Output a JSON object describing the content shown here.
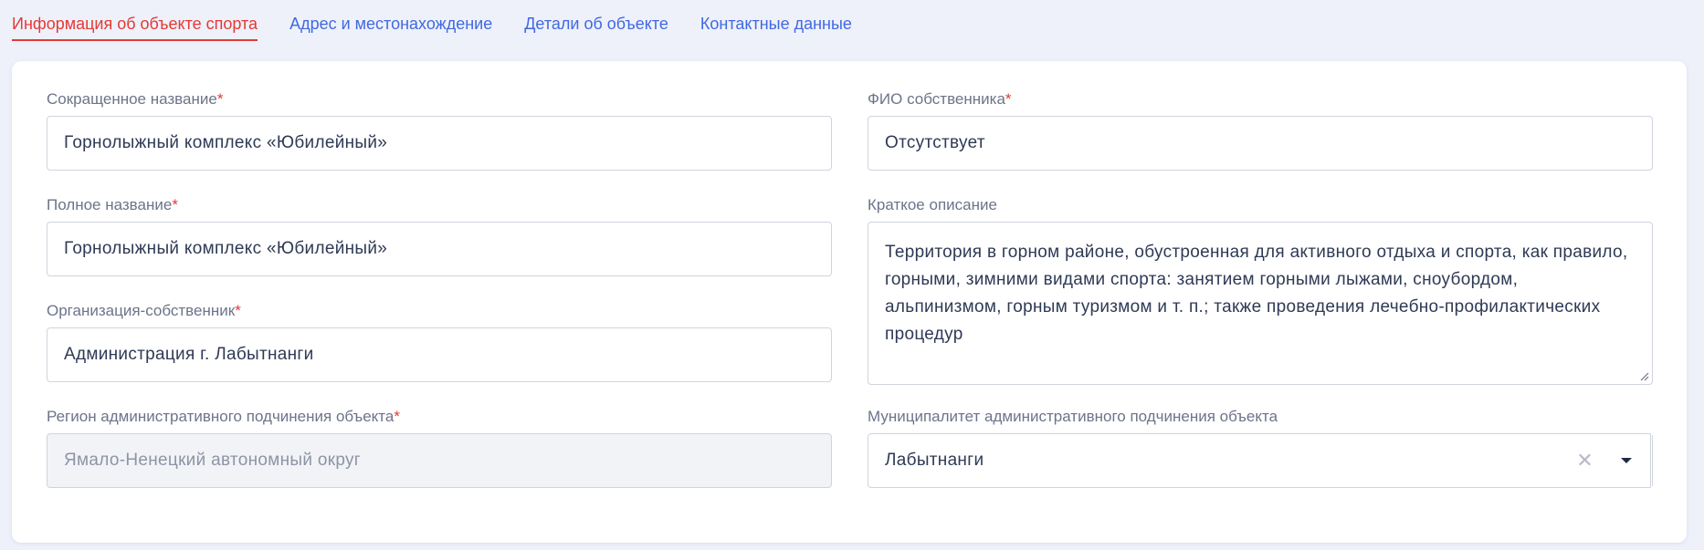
{
  "tabs": [
    {
      "label": "Информация об объекте спорта",
      "active": true
    },
    {
      "label": "Адрес и местонахождение",
      "active": false
    },
    {
      "label": "Детали об объекте",
      "active": false
    },
    {
      "label": "Контактные данные",
      "active": false
    }
  ],
  "form": {
    "short_name": {
      "label": "Сокращенное название",
      "required_mark": "*",
      "value": "Горнолыжный комплекс «Юбилейный»"
    },
    "full_name": {
      "label": "Полное название",
      "required_mark": "*",
      "value": "Горнолыжный комплекс «Юбилейный»"
    },
    "owner_org": {
      "label": "Организация-собственник",
      "required_mark": "*",
      "value": "Администрация г. Лабытнанги"
    },
    "region": {
      "label": "Регион административного подчинения объекта",
      "required_mark": "*",
      "value": "Ямало-Ненецкий автономный округ"
    },
    "owner_fio": {
      "label": "ФИО собственника",
      "required_mark": "*",
      "value": "Отсутствует"
    },
    "description": {
      "label": "Краткое описание",
      "value": "Территория в горном районе, обустроенная для активного отдыха и спорта, как правило, горными, зимними видами спорта: занятием горными лыжами, сноубордом, альпинизмом, горным туризмом и т. п.; также проведения лечебно-профилактических процедур"
    },
    "municipality": {
      "label": "Муниципалитет административного подчинения объекта",
      "value": "Лабытнанги",
      "clear_glyph": "✕"
    }
  },
  "colors": {
    "accent_active": "#e53935",
    "link": "#4169e1",
    "required": "#e53935"
  }
}
